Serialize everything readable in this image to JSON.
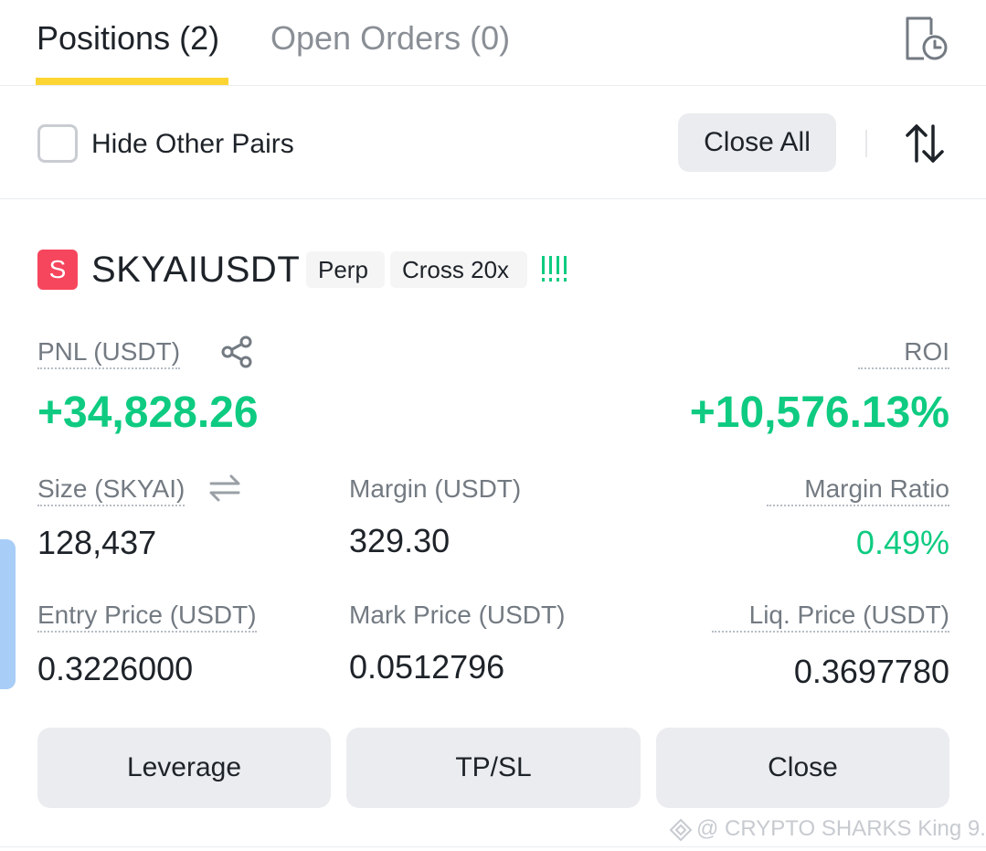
{
  "tabs": {
    "positions": "Positions (2)",
    "open_orders": "Open Orders (0)"
  },
  "filter": {
    "hide_other_pairs": "Hide Other Pairs",
    "close_all": "Close All"
  },
  "position": {
    "symbol_icon_letter": "S",
    "symbol": "SKYAIUSDT",
    "tag_type": "Perp",
    "tag_margin": "Cross 20x",
    "risk_bars": "!!!!"
  },
  "metrics": {
    "pnl_label": "PNL (USDT)",
    "pnl_value": "+34,828.26",
    "roi_label": "ROI",
    "roi_value": "+10,576.13%",
    "size_label": "Size (SKYAI)",
    "size_value": "128,437",
    "margin_label": "Margin (USDT)",
    "margin_value": "329.30",
    "margin_ratio_label": "Margin Ratio",
    "margin_ratio_value": "0.49%",
    "entry_label": "Entry Price (USDT)",
    "entry_value": "0.3226000",
    "mark_label": "Mark Price (USDT)",
    "mark_value": "0.0512796",
    "liq_label": "Liq. Price (USDT)",
    "liq_value": "0.3697780"
  },
  "actions": {
    "leverage": "Leverage",
    "tpsl": "TP/SL",
    "close": "Close"
  },
  "watermark": "@ CRYPTO SHARKS King 9...",
  "colors": {
    "accent_yellow": "#fcd535",
    "profit_green": "#0ecb81",
    "symbol_red": "#f6465d",
    "button_gray": "#eaecef"
  },
  "icons": {
    "history": "order-history-icon",
    "sort": "sort-arrows-icon",
    "share": "share-icon",
    "swap": "swap-unit-icon"
  }
}
